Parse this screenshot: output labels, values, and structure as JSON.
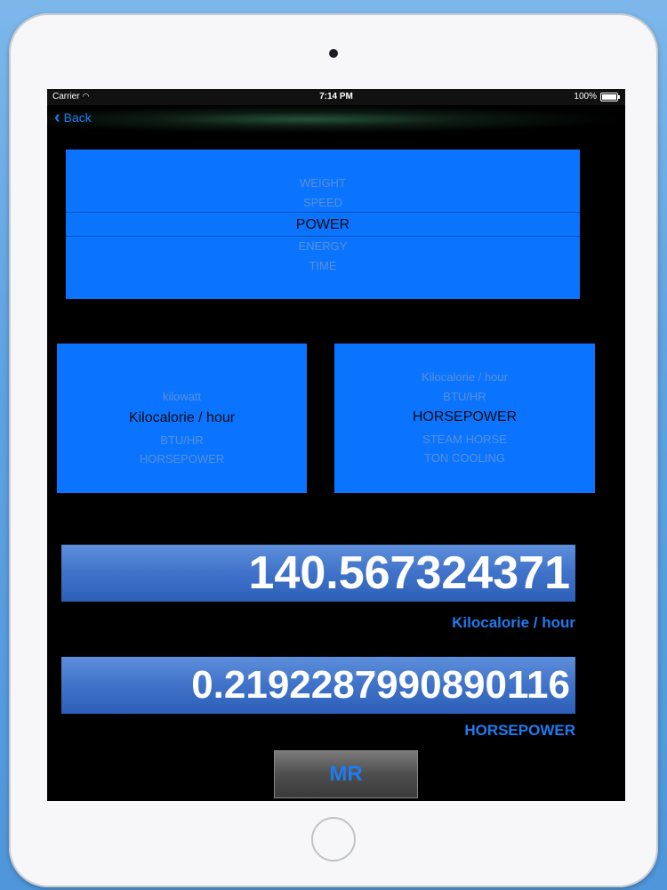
{
  "status": {
    "carrier": "Carrier",
    "time": "7:14 PM",
    "battery": "100%"
  },
  "nav": {
    "back_label": "Back"
  },
  "category_picker": {
    "above_2": "WEIGHT",
    "above_1": "SPEED",
    "selected": "POWER",
    "below_1": "ENERGY",
    "below_2": "TIME"
  },
  "from_picker": {
    "above_1": "kilowatt",
    "selected": "Kilocalorie / hour",
    "below_1": "BTU/HR",
    "below_2": "HORSEPOWER"
  },
  "to_picker": {
    "above_2": "Kilocalorie / hour",
    "above_1": "BTU/HR",
    "selected": "HORSEPOWER",
    "below_1": "STEAM HORSE",
    "below_2": "TON COOLING"
  },
  "input": {
    "value": "140.567324371",
    "unit": "Kilocalorie / hour"
  },
  "output": {
    "value": "0.2192287990890116",
    "unit": "HORSEPOWER"
  },
  "mr_button_label": "MR"
}
